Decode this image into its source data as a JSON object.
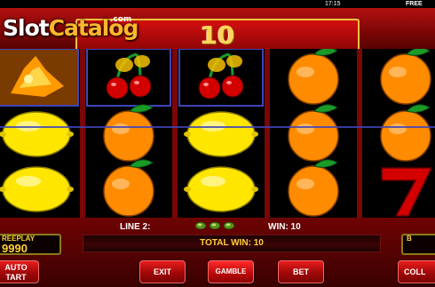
{
  "status_bar": {
    "clock": "17:15",
    "mode": "FREE"
  },
  "logo": {
    "part1": "Slot",
    "part2": "Catalog",
    "suffix": ".com"
  },
  "win_display": {
    "value": "10"
  },
  "reels": [
    [
      "bell",
      "lemon",
      "lemon"
    ],
    [
      "cherry",
      "orange",
      "orange"
    ],
    [
      "cherry",
      "lemon",
      "lemon"
    ],
    [
      "orange",
      "orange",
      "orange"
    ],
    [
      "orange",
      "orange",
      "seven"
    ]
  ],
  "info": {
    "line_label": "LINE 2:",
    "win_label": "WIN: 10",
    "total_win": "TOTAL WIN: 10"
  },
  "freeplay": {
    "label": "REEPLAY",
    "value": "9990"
  },
  "right_panel": {
    "label": "B"
  },
  "buttons": {
    "auto_line1": "AUTO",
    "auto_line2": "TART",
    "exit": "EXIT",
    "gamble": "GAMBLE",
    "bet": "BET",
    "collect": "COLL"
  },
  "colors": {
    "background": "#7a0606",
    "highlight_frame": "#3f45b8",
    "accent_gold": "#ffd23a"
  }
}
